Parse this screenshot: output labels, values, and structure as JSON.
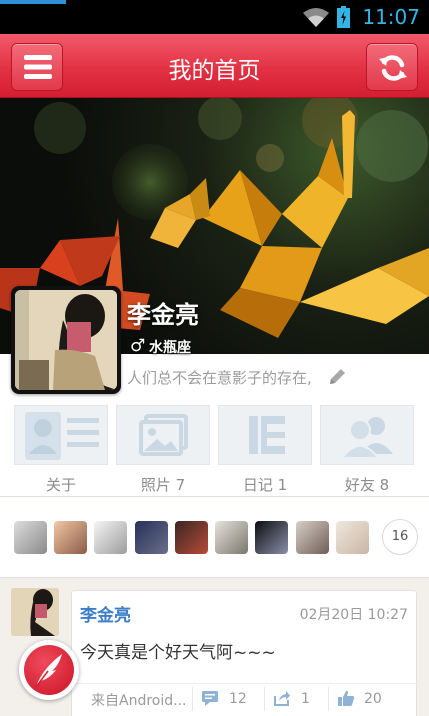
{
  "status_bar": {
    "time": "11:07",
    "wifi_icon": "wifi-icon",
    "battery_icon": "battery-icon"
  },
  "title_bar": {
    "title": "我的首页",
    "menu_icon": "menu-icon",
    "refresh_icon": "refresh-icon"
  },
  "profile": {
    "name": "李金亮",
    "gender_symbol": "♂",
    "zodiac": "水瓶座",
    "signature": "人们总不会在意影子的存在,"
  },
  "tabs": [
    {
      "label": "关于",
      "icon": "profile-card-icon"
    },
    {
      "label": "照片 7",
      "icon": "photo-icon"
    },
    {
      "label": "日记 1",
      "icon": "diary-icon"
    },
    {
      "label": "好友 8",
      "icon": "friends-icon"
    }
  ],
  "friends": {
    "count": "16"
  },
  "post": {
    "author": "李金亮",
    "time": "02月20日 10:27",
    "content": "今天真是个好天气阿~~~",
    "source": "来自Android...",
    "comments": "12",
    "shares": "1",
    "likes": "20"
  },
  "colors": {
    "accent_red": "#e23244",
    "author_blue": "#3b7fc9",
    "status_time": "#33b5e5"
  }
}
